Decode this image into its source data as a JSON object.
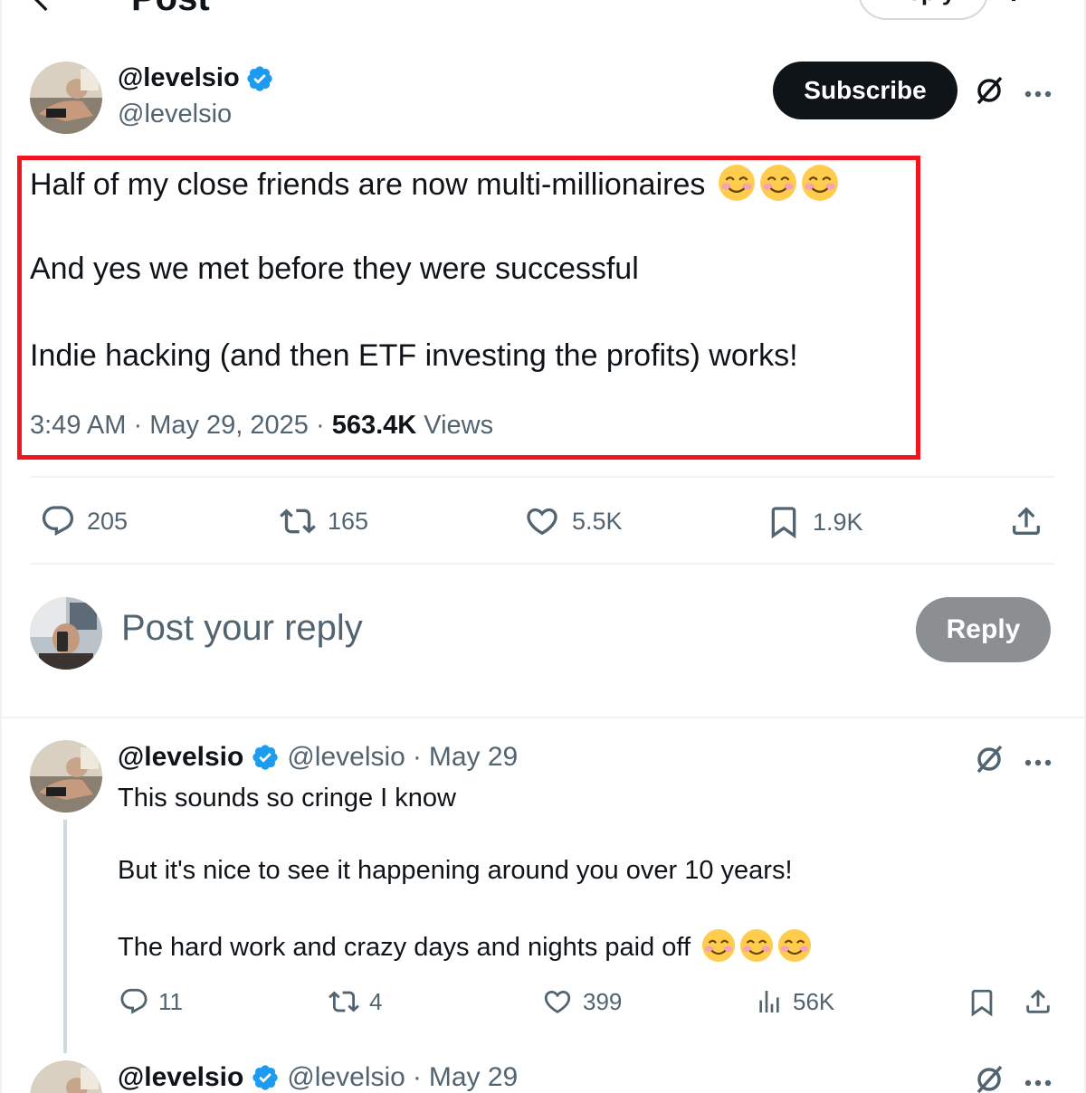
{
  "header": {
    "title": "Post",
    "reply_label": "Reply",
    "back_icon": "arrow-left-icon",
    "settings_icon": "settings-icon"
  },
  "main_post": {
    "display_name": "@levelsio",
    "handle": "@levelsio",
    "subscribe_label": "Subscribe",
    "lines": [
      "Half of my close friends are now multi-millionaires",
      "And yes we met before they were successful",
      "Indie hacking (and then ETF investing the profits) works!"
    ],
    "emoji": "smiling-face-with-smiling-eyes",
    "time": "3:49 AM",
    "date": "May 29, 2025",
    "views_count": "563.4K",
    "views_label": "Views",
    "actions": {
      "replies": "205",
      "reposts": "165",
      "likes": "5.5K",
      "bookmarks": "1.9K"
    }
  },
  "composer": {
    "placeholder": "Post your reply",
    "button_label": "Reply"
  },
  "replies": [
    {
      "display_name": "@levelsio",
      "handle": "@levelsio",
      "date": "May 29",
      "lines": [
        "This sounds so cringe I know",
        "But it's nice to see it happening around you over 10 years!",
        "The hard work and crazy days and nights paid off"
      ],
      "actions": {
        "replies": "11",
        "reposts": "4",
        "likes": "399",
        "views": "56K"
      }
    },
    {
      "display_name": "@levelsio",
      "handle": "@levelsio",
      "date": "May 29"
    }
  ],
  "colors": {
    "accent_blue": "#1d9bf0",
    "highlight_red": "#f0141e",
    "text_primary": "#0f1419",
    "text_secondary": "#536471"
  }
}
